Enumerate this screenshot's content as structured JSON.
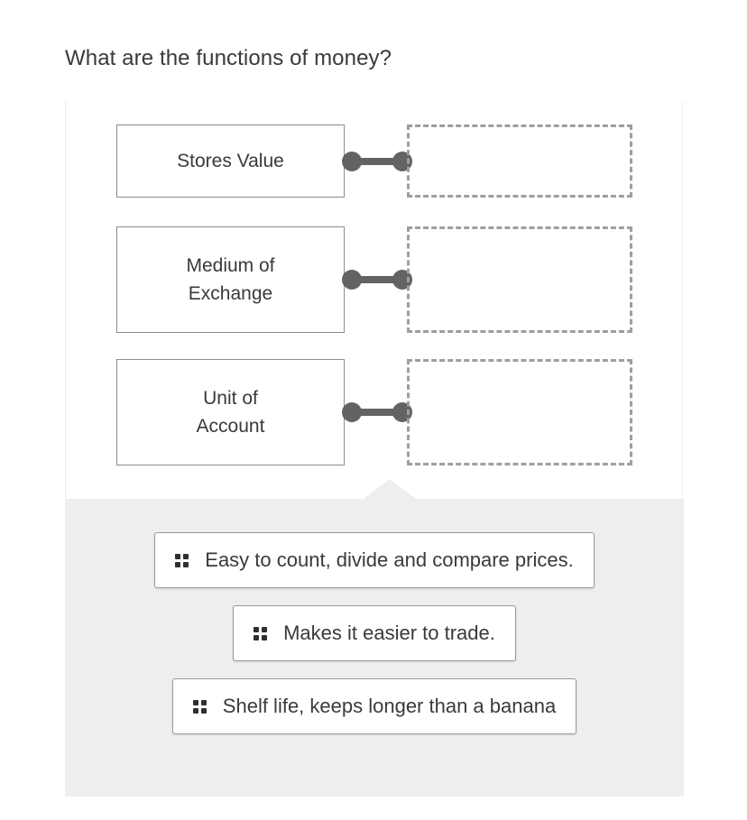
{
  "question": {
    "title": "What are the functions of money?"
  },
  "match_panel": {
    "pairs": [
      {
        "prompt": "Stores Value",
        "connector_icon": "dumbbell-connector-icon",
        "drop_zone_content": ""
      },
      {
        "prompt": "Medium of\nExchange",
        "connector_icon": "dumbbell-connector-icon",
        "drop_zone_content": ""
      },
      {
        "prompt": "Unit of\nAccount",
        "connector_icon": "dumbbell-connector-icon",
        "drop_zone_content": ""
      }
    ]
  },
  "answer_tray": {
    "options": [
      {
        "label": "Easy to count, divide and compare prices.",
        "handle_icon": "drag-handle-dots-icon"
      },
      {
        "label": "Makes it easier to trade.",
        "handle_icon": "drag-handle-dots-icon"
      },
      {
        "label": "Shelf life, keeps longer than a banana",
        "handle_icon": "drag-handle-dots-icon"
      }
    ]
  },
  "colors": {
    "panel_background": "#ffffff",
    "tray_background": "#eeeeee",
    "box_border": "#8c8c8c",
    "dashed_border": "#9e9e9e",
    "connector": "#636363",
    "text": "#3a3a3a"
  }
}
